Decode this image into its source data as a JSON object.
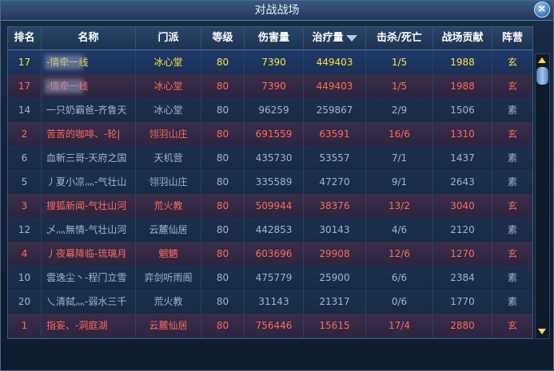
{
  "window": {
    "title": "对战战场",
    "close_label": "×"
  },
  "columns": [
    {
      "key": "rank",
      "label": "排名"
    },
    {
      "key": "name",
      "label": "名称"
    },
    {
      "key": "sect",
      "label": "门派"
    },
    {
      "key": "level",
      "label": "等级"
    },
    {
      "key": "damage",
      "label": "伤害量"
    },
    {
      "key": "heal",
      "label": "治疗量"
    },
    {
      "key": "kd",
      "label": "击杀/死亡"
    },
    {
      "key": "contrib",
      "label": "战场贡献"
    },
    {
      "key": "camp",
      "label": "阵营"
    }
  ],
  "colors": {
    "xuan_text": "#ff6a5a",
    "su_text": "#9fb4cf",
    "self_text": "#ffe23a"
  },
  "rows": [
    {
      "rank": "17",
      "name": "-情牵一线",
      "sect": "冰心堂",
      "level": "80",
      "damage": "7390",
      "heal": "449403",
      "kd": "1/5",
      "contrib": "1988",
      "camp": "玄",
      "style": "self"
    },
    {
      "rank": "17",
      "name": "-情牵一线",
      "sect": "冰心堂",
      "level": "80",
      "damage": "7390",
      "heal": "449403",
      "kd": "1/5",
      "contrib": "1988",
      "camp": "玄",
      "style": "xuan"
    },
    {
      "rank": "14",
      "name": "一只奶霸爸-齐鲁天",
      "sect": "冰心堂",
      "level": "80",
      "damage": "96259",
      "heal": "259867",
      "kd": "2/9",
      "contrib": "1506",
      "camp": "素",
      "style": "su"
    },
    {
      "rank": "2",
      "name": "苦苦的咖啡、-轮|",
      "sect": "翎羽山庄",
      "level": "80",
      "damage": "691559",
      "heal": "63591",
      "kd": "16/6",
      "contrib": "1310",
      "camp": "玄",
      "style": "xuan"
    },
    {
      "rank": "6",
      "name": "血斬三哥-天府之国",
      "sect": "天机营",
      "level": "80",
      "damage": "435730",
      "heal": "53557",
      "kd": "7/1",
      "contrib": "1437",
      "camp": "素",
      "style": "su"
    },
    {
      "rank": "5",
      "name": "丿夏小凉灬-气壮山",
      "sect": "翎羽山庄",
      "level": "80",
      "damage": "335589",
      "heal": "47270",
      "kd": "9/1",
      "contrib": "2643",
      "camp": "素",
      "style": "su"
    },
    {
      "rank": "3",
      "name": "搜狐新闻-气壮山河",
      "sect": "荒火教",
      "level": "80",
      "damage": "509944",
      "heal": "38376",
      "kd": "13/2",
      "contrib": "3040",
      "camp": "玄",
      "style": "xuan"
    },
    {
      "rank": "12",
      "name": "乄灬無情-气壮山河",
      "sect": "云麓仙居",
      "level": "80",
      "damage": "442853",
      "heal": "30143",
      "kd": "4/6",
      "contrib": "2120",
      "camp": "素",
      "style": "su"
    },
    {
      "rank": "4",
      "name": "丿夜幕降临-琉璃月",
      "sect": "魍魉",
      "level": "80",
      "damage": "603696",
      "heal": "29908",
      "kd": "12/6",
      "contrib": "1270",
      "camp": "玄",
      "style": "xuan"
    },
    {
      "rank": "10",
      "name": "雲逸尘丶-程门立雪",
      "sect": "弈剑听雨阁",
      "level": "80",
      "damage": "475779",
      "heal": "25900",
      "kd": "6/6",
      "contrib": "2384",
      "camp": "素",
      "style": "su"
    },
    {
      "rank": "20",
      "name": "乀清弑灬-弱水三千",
      "sect": "荒火教",
      "level": "80",
      "damage": "31143",
      "heal": "21317",
      "kd": "0/6",
      "contrib": "1770",
      "camp": "素",
      "style": "su"
    },
    {
      "rank": "1",
      "name": "指妄、-洞庭湖",
      "sect": "云麓仙居",
      "level": "80",
      "damage": "756446",
      "heal": "15615",
      "kd": "17/4",
      "contrib": "2880",
      "camp": "玄",
      "style": "xuan"
    }
  ]
}
